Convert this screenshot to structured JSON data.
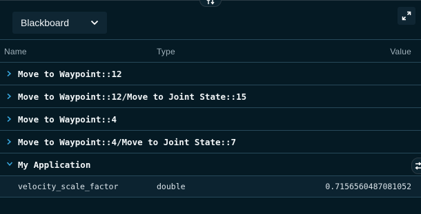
{
  "panel": {
    "selector": {
      "value": "Blackboard",
      "icon": "chevron-down-icon"
    },
    "expand_icon": "expand-icon",
    "resize_icon": "resize-vertical-icon"
  },
  "table": {
    "columns": {
      "name": "Name",
      "type": "Type",
      "value": "Value"
    },
    "groups": [
      {
        "label": "Move to Waypoint::12",
        "expanded": false
      },
      {
        "label": "Move to Waypoint::12/Move to Joint State::15",
        "expanded": false
      },
      {
        "label": "Move to Waypoint::4",
        "expanded": false
      },
      {
        "label": "Move to Waypoint::4/Move to Joint State::7",
        "expanded": false
      },
      {
        "label": "My Application",
        "expanded": true,
        "entries": [
          {
            "name": "velocity_scale_factor",
            "type": "double",
            "value": "0.7156560487081052"
          }
        ]
      }
    ]
  },
  "colors": {
    "background": "#051a24",
    "divider": "#27495a",
    "chevron": "#39a9e0"
  }
}
